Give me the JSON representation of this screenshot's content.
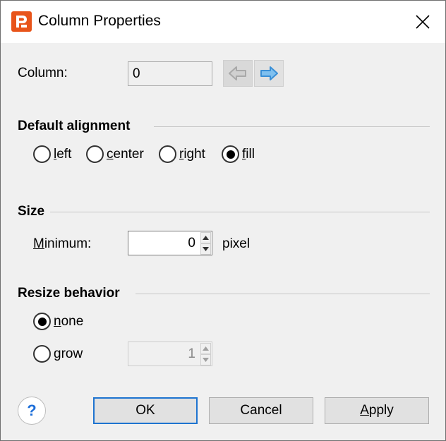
{
  "window": {
    "title": "Column Properties",
    "app_icon": "pd-logo-icon",
    "close_icon": "close-icon"
  },
  "column": {
    "label": "Column:",
    "value": "0",
    "prev_icon": "arrow-left-icon",
    "next_icon": "arrow-right-icon",
    "prev_enabled": false,
    "next_enabled": true
  },
  "alignment": {
    "title": "Default alignment",
    "options": [
      {
        "pre": "",
        "mn": "l",
        "post": "eft",
        "selected": false
      },
      {
        "pre": "",
        "mn": "c",
        "post": "enter",
        "selected": false
      },
      {
        "pre": "",
        "mn": "r",
        "post": "ight",
        "selected": false
      },
      {
        "pre": "",
        "mn": "f",
        "post": "ill",
        "selected": true
      }
    ]
  },
  "size": {
    "title": "Size",
    "minimum_label_mn": "M",
    "minimum_label_rest": "inimum:",
    "minimum_value": "0",
    "unit": "pixel"
  },
  "resize": {
    "title": "Resize behavior",
    "none_mn": "n",
    "none_rest": "one",
    "none_selected": true,
    "grow_mn": "g",
    "grow_rest": "row",
    "grow_selected": false,
    "grow_value": "1"
  },
  "buttons": {
    "help": "?",
    "ok": "OK",
    "cancel": "Cancel",
    "apply_mn": "A",
    "apply_rest": "pply"
  },
  "colors": {
    "accent": "#1e74d0",
    "logo": "#e8541a",
    "arrow_enabled": "#3a8fd6",
    "arrow_disabled": "#a9a9a9"
  }
}
